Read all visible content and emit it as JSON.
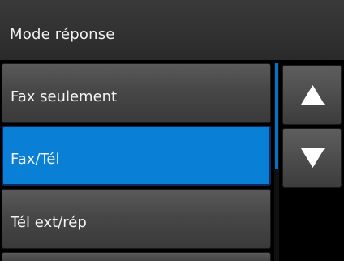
{
  "header": {
    "title": "Mode réponse"
  },
  "options": [
    {
      "label": "Fax seulement",
      "selected": false
    },
    {
      "label": "Fax/Tél",
      "selected": true
    },
    {
      "label": "Tél ext/rép",
      "selected": false
    },
    {
      "label": "",
      "selected": false
    }
  ],
  "scroll": {
    "up_icon": "triangle-up-icon",
    "down_icon": "triangle-down-icon"
  },
  "colors": {
    "selected": "#0a7fd6",
    "item": "#474747",
    "background": "#000000",
    "text": "#f4f4f4"
  }
}
